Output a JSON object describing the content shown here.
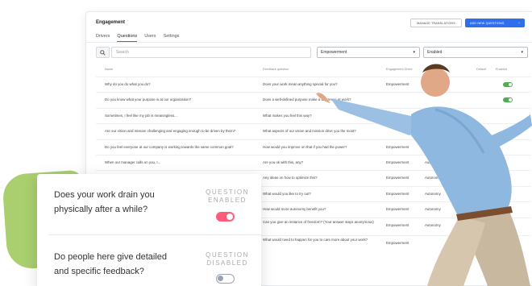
{
  "app": {
    "title": "Engagement",
    "manage_button": "MANAGE TRANSLATIONS",
    "add_button": "ADD NEW QUESTIONS",
    "tabs": [
      "Drivers",
      "Questions",
      "Users",
      "Settings"
    ],
    "active_tab": "Questions"
  },
  "filters": {
    "search_placeholder": "Search",
    "driver_select": "Empowerment",
    "status_select": "Enabled"
  },
  "table": {
    "headers": {
      "name": "Name",
      "feedback": "Feedback question",
      "driver": "Engagement Driver",
      "default": "Default",
      "enabled": "Enabled"
    },
    "rows": [
      {
        "q": "Why do you do what you do?",
        "fb": "Does your work mean anything special for you?",
        "d": "Empowerment",
        "s": ""
      },
      {
        "q": "Do you know what your purpose is at our organization?",
        "fb": "Does a well-defined purpose make a difference at work?",
        "d": "",
        "s": ""
      },
      {
        "q": "Sometimes, I feel like my job is meaningless...",
        "fb": "What makes you feel this way?",
        "d": "",
        "s": ""
      },
      {
        "q": "Are our vision and mission challenging and engaging enough to be driven by them?",
        "fb": "What aspects of our vision and mission drive you the most?",
        "d": "",
        "s": ""
      },
      {
        "q": "Do you feel everyone at our company is working towards the same common goal?",
        "fb": "How would you improve on that if you had the power?",
        "d": "Empowerment",
        "s": "Sense of Purpose"
      },
      {
        "q": "When our manager calls on you, I...",
        "fb": "Are you ok with this, any?",
        "d": "Empowerment",
        "s": "Autonomy"
      },
      {
        "q": "",
        "fb": "Any ideas on how to optimize this?",
        "d": "Empowerment",
        "s": "Autonomy"
      },
      {
        "q": "",
        "fb": "What would you like to try out?",
        "d": "Empowerment",
        "s": "Autonomy"
      },
      {
        "q": "",
        "fb": "How would more autonomy benefit you?",
        "d": "Empowerment",
        "s": "Autonomy"
      },
      {
        "q": "",
        "fb": "Can you give an instance of freedom? (Your answer stays anonymous)",
        "d": "Empowerment",
        "s": "Autonomy"
      },
      {
        "q": "",
        "fb": "What would need to happen for you to care more about your work?",
        "d": "Empowerment",
        "s": ""
      }
    ]
  },
  "overlay": {
    "q1": "Does your work drain you physically after a while?",
    "q1_status": "QUESTION ENABLED",
    "q2": "Do people here give detailed and specific feedback?",
    "q2_status": "QUESTION DISABLED"
  },
  "colors": {
    "accent_blue": "#2f6fed",
    "toggle_on_pink": "#ff5c7a",
    "toggle_green": "#4caf50",
    "blob_green": "#a9cf6e"
  },
  "icons": [
    "search-icon",
    "chevron-down-icon",
    "info-icon"
  ]
}
